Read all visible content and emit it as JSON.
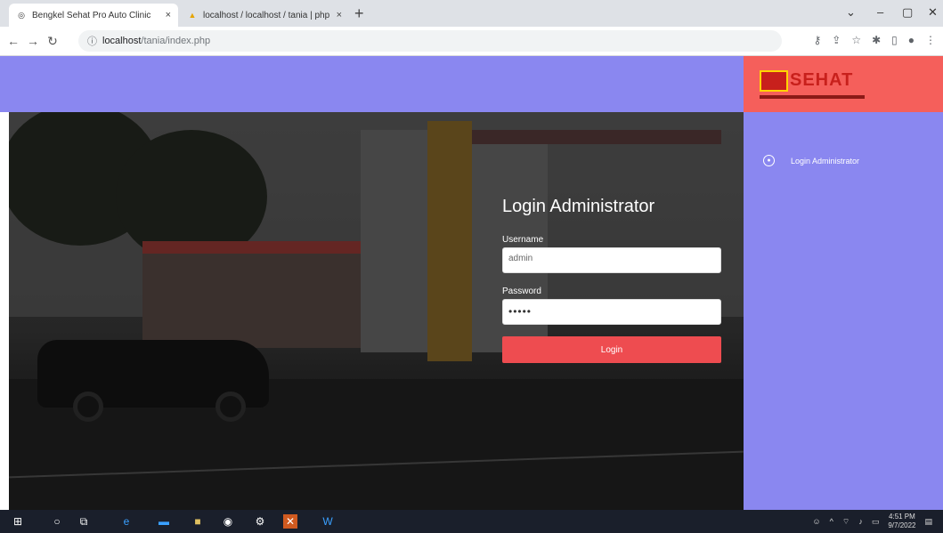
{
  "browser": {
    "tabs": [
      {
        "title": "Bengkel Sehat Pro Auto Clinic",
        "active": true
      },
      {
        "title": "localhost / localhost / tania | php",
        "active": false
      }
    ],
    "url_host": "localhost",
    "url_path": "/tania/index.php"
  },
  "login": {
    "title": "Login Administrator",
    "username_label": "Username",
    "username_value": "admin",
    "password_label": "Password",
    "password_value": "•••••",
    "button_label": "Login"
  },
  "brand": {
    "name": "SEHAT"
  },
  "sidebar": {
    "items": [
      {
        "label": "Login Administrator"
      }
    ]
  },
  "taskbar": {
    "time": "4:51 PM",
    "date": "9/7/2022"
  },
  "colors": {
    "accent": "#8a87f0",
    "brand_red": "#f55f5b",
    "button": "#ee4c50"
  }
}
